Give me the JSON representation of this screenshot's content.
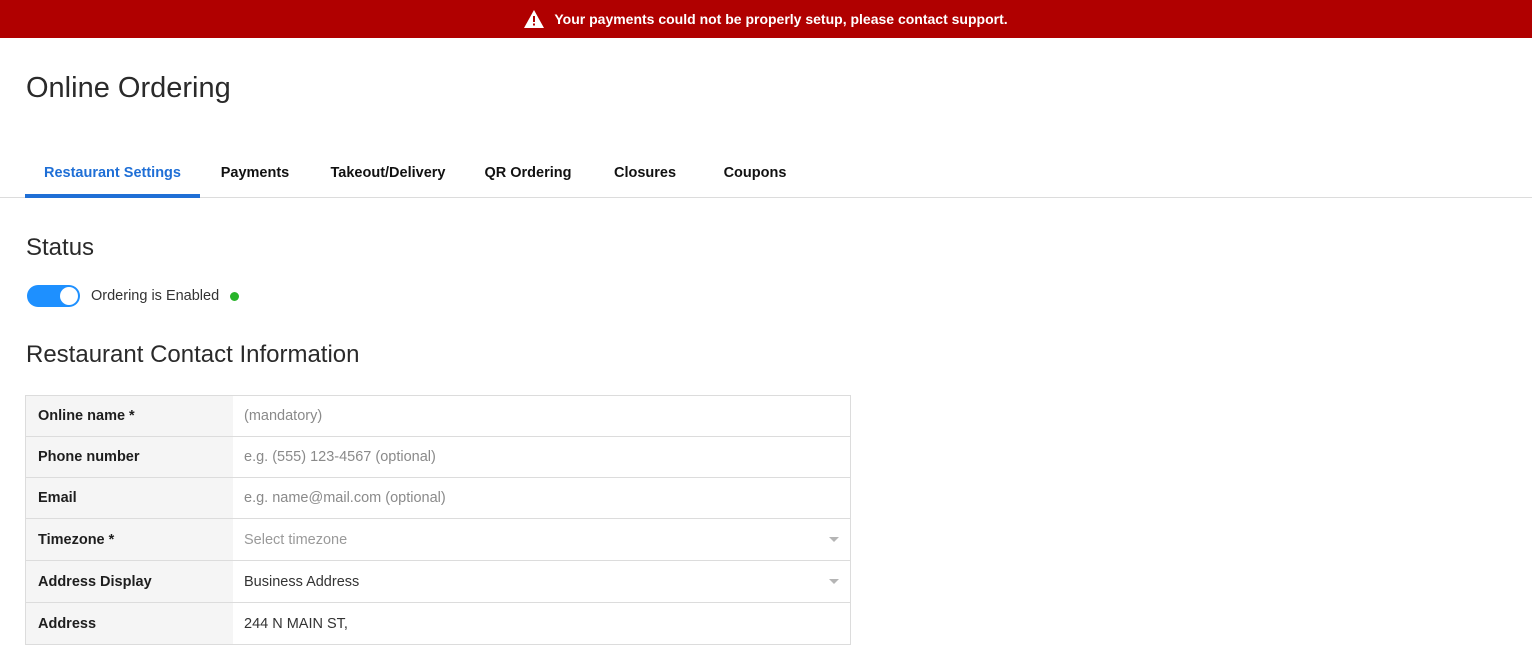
{
  "alert": {
    "icon": "warning-icon",
    "message": "Your payments could not be properly setup, please contact support.",
    "background": "#b00000"
  },
  "page": {
    "title": "Online Ordering"
  },
  "tabs": [
    {
      "label": "Restaurant Settings",
      "active": true
    },
    {
      "label": "Payments",
      "active": false
    },
    {
      "label": "Takeout/Delivery",
      "active": false
    },
    {
      "label": "QR Ordering",
      "active": false
    },
    {
      "label": "Closures",
      "active": false
    },
    {
      "label": "Coupons",
      "active": false
    }
  ],
  "status": {
    "title": "Status",
    "toggle_on": true,
    "label": "Ordering is Enabled",
    "dot_color": "#28b42a"
  },
  "contact": {
    "title": "Restaurant Contact Information",
    "fields": {
      "online_name": {
        "label": "Online name *",
        "value": "",
        "placeholder": "(mandatory)"
      },
      "phone": {
        "label": "Phone number",
        "value": "",
        "placeholder": "e.g. (555) 123-4567 (optional)"
      },
      "email": {
        "label": "Email",
        "value": "",
        "placeholder": "e.g. name@mail.com (optional)"
      },
      "timezone": {
        "label": "Timezone *",
        "placeholder": "Select timezone"
      },
      "address_display": {
        "label": "Address Display",
        "value": "Business Address"
      },
      "address": {
        "label": "Address",
        "value": "244 N MAIN ST,"
      }
    }
  },
  "colors": {
    "accent": "#1f6fd6",
    "toggle": "#1e90ff"
  }
}
